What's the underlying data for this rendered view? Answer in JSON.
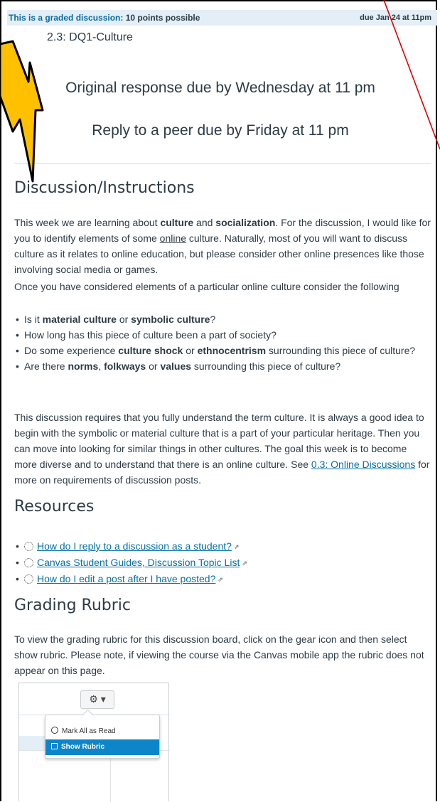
{
  "banner": {
    "graded_label": "This is a graded discussion:",
    "points": "10 points possible",
    "due": "due Jan 24 at 11pm"
  },
  "topic_title": "2.3: DQ1-Culture",
  "due_lines": {
    "original": "Original response due by Wednesday at 11 pm",
    "reply": "Reply to a peer due by Friday at 11 pm"
  },
  "discussion": {
    "heading": "Discussion/Instructions",
    "p1": {
      "a": "This week we are learning about ",
      "b1": "culture",
      "c": " and ",
      "b2": "socialization",
      "d": ". For the discussion, I would like for you to identify elements of some ",
      "u": "online",
      "e": " culture. Naturally, most of you will want to discuss culture as it relates to online education, but please consider other online presences like those involving social media or games."
    },
    "p2": "Once you have considered elements of a particular online culture consider the following",
    "bullets": {
      "b1": {
        "a": "Is it ",
        "s1": "material culture",
        "c": " or ",
        "s2": "symbolic culture",
        "d": "?"
      },
      "b2": "How long has this piece of culture been a part of society?",
      "b3": {
        "a": "Do some experience ",
        "s1": "culture shock",
        "c": " or ",
        "s2": "ethnocentrism",
        "d": " surrounding this piece of culture?"
      },
      "b4": {
        "a": "Are there ",
        "s1": "norms",
        "c": ", ",
        "s2": "folkways",
        "d": " or ",
        "s3": "values",
        "e": " surrounding this piece of culture?"
      }
    },
    "p3": {
      "a": "This discussion requires that you fully understand the term culture. It is always a good idea to begin with the symbolic or material culture that is a part of your particular heritage. Then you can move into looking for similar things in other cultures. The goal this week is to become more diverse and to understand that there is an online culture. See ",
      "link": "0.3: Online Discussions",
      "b": " for more on requirements of discussion posts."
    }
  },
  "resources": {
    "heading": "Resources",
    "items": [
      {
        "label": "How do I reply to a discussion as a student?",
        "icon": "canvas-guides-icon"
      },
      {
        "label": "Canvas Student Guides, Discussion Topic List",
        "icon": "canvas-guides-icon"
      },
      {
        "label": "How do I edit a post after I have posted?",
        "icon": "canvas-guides-icon"
      }
    ]
  },
  "rubric": {
    "heading": "Grading Rubric",
    "text": "To view the grading rubric for this discussion board, click on the gear icon and then select show rubric. Please note, if viewing the course via the Canvas mobile app the rubric does not appear on this page.",
    "screenshot": {
      "gear_icon": "gear-icon",
      "menu_items": [
        "Mark All as Read",
        "Show Rubric"
      ]
    }
  },
  "colors": {
    "link": "#0770a3",
    "banner_bg": "#e3eef7",
    "annotation_arrow": "#ffc000",
    "annotation_line": "#e00000"
  }
}
